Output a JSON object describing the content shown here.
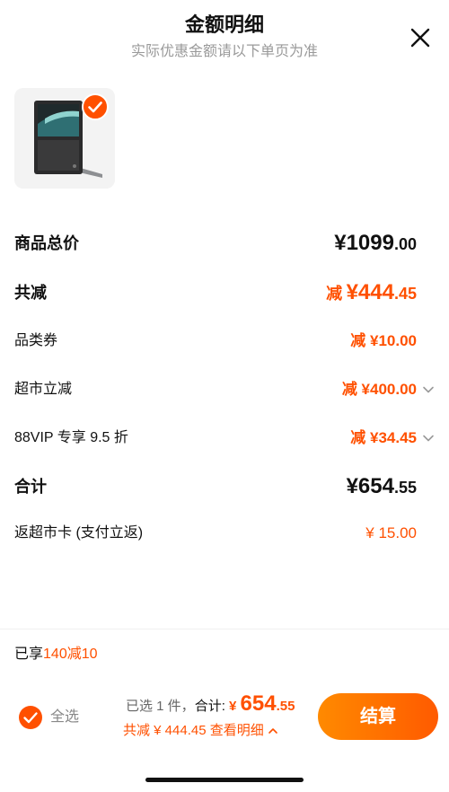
{
  "header": {
    "title": "金额明细",
    "subtitle": "实际优惠金额请以下单页为准"
  },
  "details": {
    "goods_total": {
      "label": "商品总价",
      "currency": "¥",
      "main": "1099",
      "cents": ".00"
    },
    "total_reduce": {
      "label": "共减",
      "prefix": "减",
      "currency": "¥",
      "main": "444",
      "cents": ".45"
    },
    "category_coupon": {
      "label": "品类券",
      "value": "减 ¥10.00"
    },
    "supermarket_reduce": {
      "label": "超市立减",
      "value": "减 ¥400.00"
    },
    "vip_discount": {
      "label": "88VIP 专享 9.5 折",
      "value": "减 ¥34.45"
    },
    "sum": {
      "label": "合计",
      "currency": "¥",
      "main": "654",
      "cents": ".55"
    },
    "cashback": {
      "label": "返超市卡 (支付立返)",
      "value": "¥ 15.00"
    }
  },
  "promo": {
    "prefix": "已享",
    "highlight": "140减10"
  },
  "footer": {
    "select_all": "全选",
    "selected_count": "已选 1 件，",
    "total_label": "合计:",
    "total_currency": "¥",
    "total_main": "654",
    "total_cents": ".55",
    "reduce_text": "共减 ¥ 444.45",
    "view_detail": "查看明细",
    "checkout": "结算"
  },
  "colors": {
    "accent": "#ff5000",
    "button_gradient_start": "#ff8a00",
    "button_gradient_end": "#ff5a00"
  },
  "icons": {
    "close": "close-icon",
    "check": "check-circle-icon",
    "chevron": "chevron-down-icon",
    "chevron_up": "chevron-up-icon"
  }
}
